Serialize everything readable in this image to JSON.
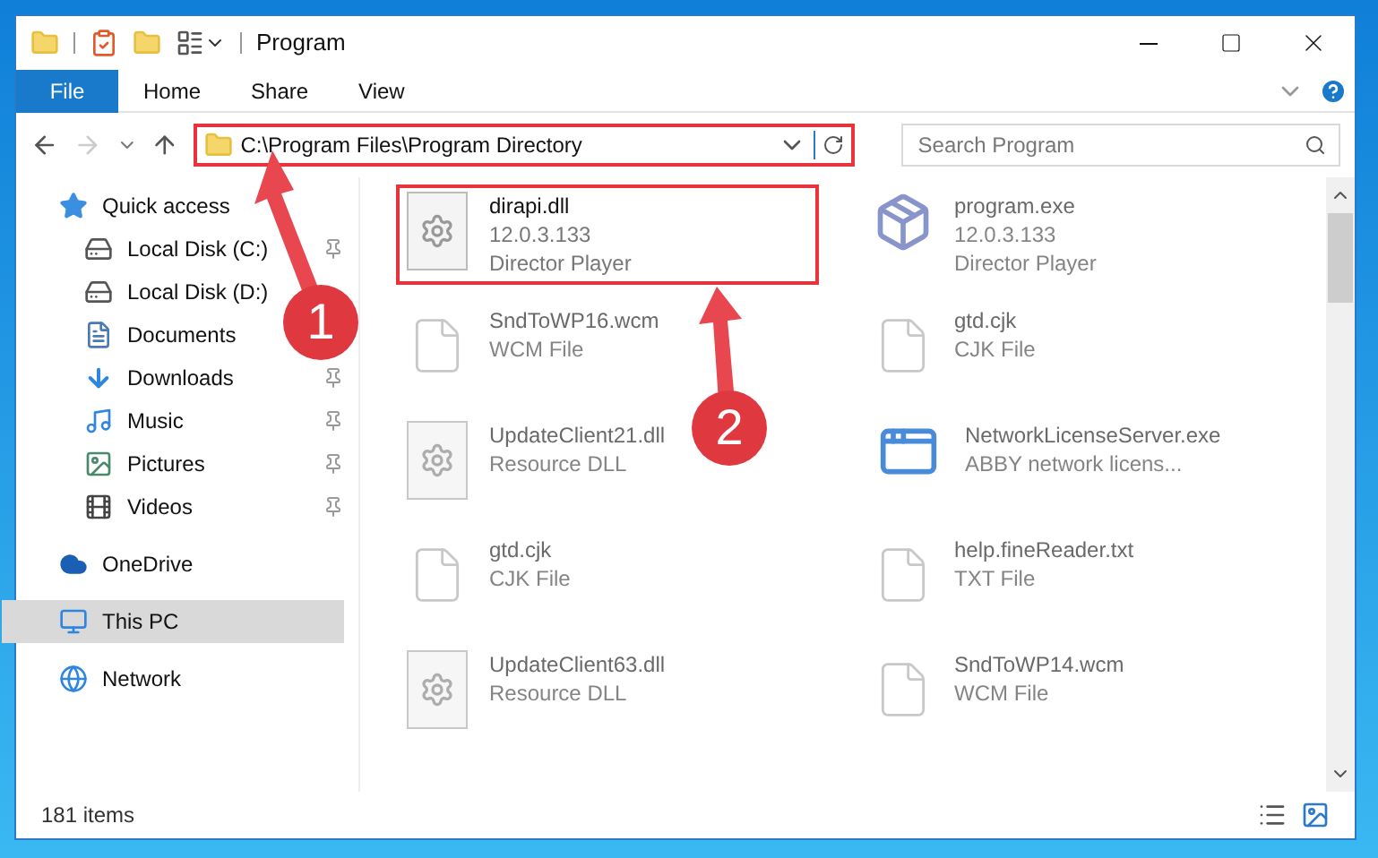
{
  "window": {
    "title": "Program"
  },
  "ribbon_tabs": [
    {
      "label": "File",
      "selected": true
    },
    {
      "label": "Home",
      "selected": false
    },
    {
      "label": "Share",
      "selected": false
    },
    {
      "label": "View",
      "selected": false
    }
  ],
  "address_bar": {
    "path": "C:\\Program Files\\Program Directory",
    "highlighted": true
  },
  "search": {
    "placeholder": "Search Program"
  },
  "sidebar": {
    "items": [
      {
        "label": "Quick access",
        "kind": "star",
        "selected": false,
        "children": [
          {
            "label": "Local Disk (C:)",
            "kind": "diskc",
            "pinned": true,
            "selected": false
          },
          {
            "label": "Local Disk (D:)",
            "kind": "disk",
            "pinned": false,
            "selected": false
          },
          {
            "label": "Documents",
            "kind": "docs",
            "pinned": false,
            "selected": false
          },
          {
            "label": "Downloads",
            "kind": "down",
            "pinned": true,
            "selected": false
          },
          {
            "label": "Music",
            "kind": "music",
            "pinned": true,
            "selected": false
          },
          {
            "label": "Pictures",
            "kind": "pics",
            "pinned": true,
            "selected": false
          },
          {
            "label": "Videos",
            "kind": "video",
            "pinned": true,
            "selected": false
          }
        ]
      },
      {
        "label": "OneDrive",
        "kind": "cloud",
        "selected": false
      },
      {
        "label": "This PC",
        "kind": "pc",
        "selected": true
      },
      {
        "label": "Network",
        "kind": "net",
        "selected": false
      }
    ]
  },
  "files": [
    {
      "name": "dirapi.dll",
      "details": [
        "12.0.3.133",
        "Director Player"
      ],
      "kind": "gear",
      "highlighted": true,
      "blurred": false
    },
    {
      "name": "program.exe",
      "details": [
        "12.0.3.133",
        "Director Player"
      ],
      "kind": "app",
      "highlighted": false,
      "blurred": true
    },
    {
      "name": "SndToWP16.wcm",
      "details": [
        "WCM File"
      ],
      "kind": "blank",
      "highlighted": false,
      "blurred": true
    },
    {
      "name": "gtd.cjk",
      "details": [
        "CJK File"
      ],
      "kind": "blank",
      "highlighted": false,
      "blurred": true
    },
    {
      "name": "UpdateClient21.dll",
      "details": [
        "Resource DLL"
      ],
      "kind": "gear",
      "highlighted": false,
      "blurred": true
    },
    {
      "name": "NetworkLicenseServer.exe",
      "details": [
        "ABBY network licens..."
      ],
      "kind": "win",
      "highlighted": false,
      "blurred": true
    },
    {
      "name": "gtd.cjk",
      "details": [
        "CJK File"
      ],
      "kind": "blank",
      "highlighted": false,
      "blurred": true
    },
    {
      "name": "help.fineReader.txt",
      "details": [
        "TXT File"
      ],
      "kind": "blank",
      "highlighted": false,
      "blurred": true
    },
    {
      "name": "UpdateClient63.dll",
      "details": [
        "Resource DLL"
      ],
      "kind": "gear",
      "highlighted": false,
      "blurred": true
    },
    {
      "name": "SndToWP14.wcm",
      "details": [
        "WCM File"
      ],
      "kind": "blank",
      "highlighted": false,
      "blurred": true
    }
  ],
  "status_bar": {
    "count": "181 items"
  },
  "callouts": [
    {
      "number": "1"
    },
    {
      "number": "2"
    }
  ]
}
